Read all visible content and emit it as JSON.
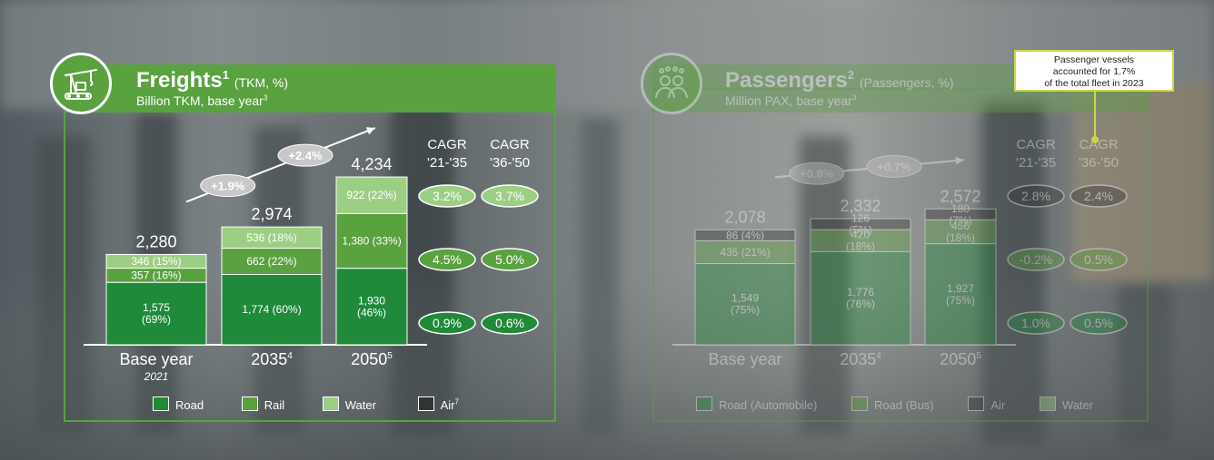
{
  "freight": {
    "title": "Freights",
    "title_sup": "1",
    "title_unit": "(TKM, %)",
    "subtitle": "Billion TKM, base year",
    "subtitle_sup": "3",
    "icon": "crane-icon"
  },
  "passengers": {
    "title": "Passengers",
    "title_sup": "2",
    "title_unit": "(Passengers, %)",
    "subtitle": "Million PAX, base year",
    "subtitle_sup": "3",
    "icon": "people-icon"
  },
  "callout": {
    "line1": "Passenger vessels",
    "line2": "accounted for 1.7%",
    "line3": "of the total fleet in 2023"
  },
  "colors": {
    "road": "#1e8a3a",
    "rail": "#5aa13f",
    "water": "#9ccf84",
    "air": "#333333",
    "accent": "#5aa13f"
  },
  "chart_data": [
    {
      "type": "bar",
      "stacked": true,
      "categories": [
        "Base year",
        "2035",
        "2050"
      ],
      "category_sups": [
        "",
        "4",
        "5"
      ],
      "category_sub": [
        "2021",
        "",
        ""
      ],
      "totals": [
        "2,280",
        "2,974",
        "4,234"
      ],
      "series": [
        {
          "name": "Road",
          "values": [
            1575,
            1774,
            1930
          ],
          "labels": [
            [
              "1,575",
              "(69%)"
            ],
            [
              "1,774 (60%)"
            ],
            [
              "1,930",
              "(46%)"
            ]
          ]
        },
        {
          "name": "Rail",
          "values": [
            357,
            662,
            1380
          ],
          "labels": [
            [
              "357 (16%)"
            ],
            [
              "662 (22%)"
            ],
            [
              "1,380 (33%)"
            ]
          ]
        },
        {
          "name": "Water",
          "values": [
            346,
            536,
            922
          ],
          "labels": [
            [
              "346 (15%)"
            ],
            [
              "536 (18%)"
            ],
            [
              "922 (22%)"
            ]
          ]
        },
        {
          "name": "Air",
          "values": [
            0,
            0,
            0
          ],
          "labels": [
            [],
            [],
            []
          ]
        }
      ],
      "legend": [
        {
          "name": "Road",
          "sup": ""
        },
        {
          "name": "Rail",
          "sup": ""
        },
        {
          "name": "Water",
          "sup": ""
        },
        {
          "name": "Air",
          "sup": "7"
        }
      ],
      "growth": [
        "+1.9%",
        "+2.4%"
      ],
      "cagr_headers": [
        [
          "CAGR",
          "'21-'35"
        ],
        [
          "CAGR",
          "'36-'50"
        ]
      ],
      "cagr_rows": [
        {
          "series": "Water",
          "values": [
            "3.2%",
            "3.7%"
          ]
        },
        {
          "series": "Rail",
          "values": [
            "4.5%",
            "5.0%"
          ]
        },
        {
          "series": "Road",
          "values": [
            "0.9%",
            "0.6%"
          ]
        }
      ]
    },
    {
      "type": "bar",
      "stacked": true,
      "categories": [
        "Base year",
        "2035",
        "2050"
      ],
      "category_sups": [
        "",
        "4",
        "5"
      ],
      "category_sub": [
        "",
        "",
        ""
      ],
      "totals": [
        "2,078",
        "2,332",
        "2,572"
      ],
      "series": [
        {
          "name": "Road (Automobile)",
          "values": [
            1549,
            1776,
            1927
          ],
          "labels": [
            [
              "1,549",
              "(75%)"
            ],
            [
              "1,776",
              "(76%)"
            ],
            [
              "1,927",
              "(75%)"
            ]
          ]
        },
        {
          "name": "Road (Bus)",
          "values": [
            435,
            420,
            456
          ],
          "labels": [
            [
              "435 (21%)"
            ],
            [
              "420",
              "(18%)"
            ],
            [
              "456",
              "(18%)"
            ]
          ]
        },
        {
          "name": "Air",
          "values": [
            86,
            126,
            180
          ],
          "labels": [
            [
              "86 (4%)"
            ],
            [
              "126",
              "(5%)"
            ],
            [
              "180",
              "(7%)"
            ]
          ]
        },
        {
          "name": "Water",
          "values": [
            0,
            0,
            0
          ],
          "labels": [
            [],
            [],
            []
          ]
        }
      ],
      "legend": [
        {
          "name": "Road (Automobile)",
          "sup": ""
        },
        {
          "name": "Road (Bus)",
          "sup": ""
        },
        {
          "name": "Air",
          "sup": ""
        },
        {
          "name": "Water",
          "sup": ""
        }
      ],
      "growth": [
        "+0.8%",
        "+0.7%"
      ],
      "cagr_headers": [
        [
          "CAGR",
          "'21-'35"
        ],
        [
          "CAGR",
          "'36-'50"
        ]
      ],
      "cagr_rows": [
        {
          "series": "Air",
          "values": [
            "2.8%",
            "2.4%"
          ]
        },
        {
          "series": "Road (Bus)",
          "values": [
            "-0.2%",
            "0.5%"
          ]
        },
        {
          "series": "Road (Automobile)",
          "values": [
            "1.0%",
            "0.5%"
          ]
        }
      ]
    }
  ]
}
